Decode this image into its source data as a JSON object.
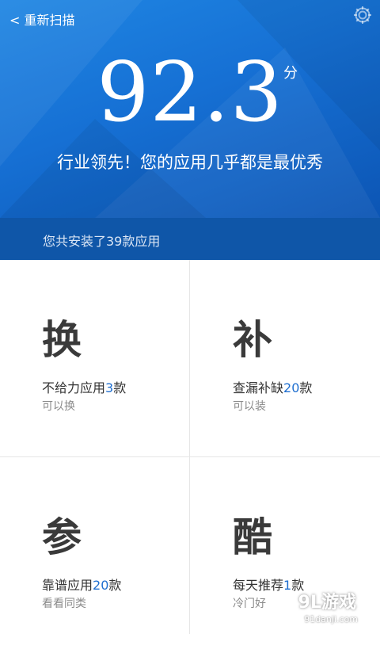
{
  "header": {
    "back_label": "< 重新扫描",
    "settings_icon": "gear-icon"
  },
  "score": {
    "value": "92.3",
    "unit": "分",
    "verdict": "行业领先！您的应用几乎都是最优秀"
  },
  "summary": {
    "text": "您共安装了39款应用"
  },
  "tiles": [
    {
      "glyph": "换",
      "title_prefix": "不给力应用",
      "count": "3",
      "title_suffix": "款",
      "subtitle": "可以换"
    },
    {
      "glyph": "补",
      "title_prefix": "查漏补缺",
      "count": "20",
      "title_suffix": "款",
      "subtitle": "可以装"
    },
    {
      "glyph": "参",
      "title_prefix": "靠谱应用",
      "count": "20",
      "title_suffix": "款",
      "subtitle": "看看同类"
    },
    {
      "glyph": "酷",
      "title_prefix": "每天推荐",
      "count": "1",
      "title_suffix": "款",
      "subtitle": "冷门好"
    }
  ],
  "watermark": {
    "brand": "9L游戏",
    "url": "91danji.com"
  },
  "colors": {
    "hero_blue": "#1670d4",
    "summary_bar": "#0f56a8",
    "accent_number": "#1f6fd0"
  }
}
